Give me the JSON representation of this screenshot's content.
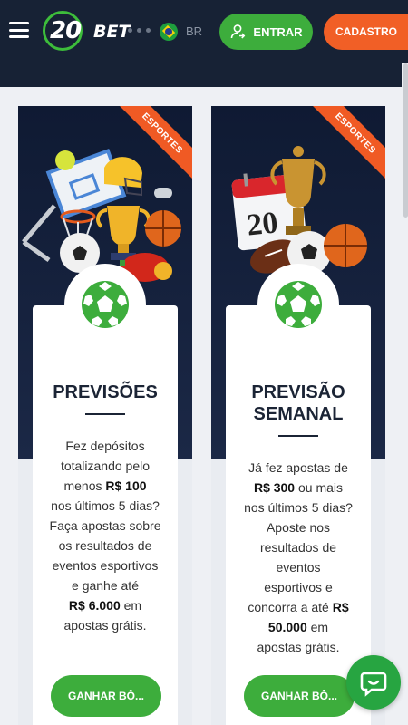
{
  "header": {
    "logo_number": "20",
    "logo_word": "BET",
    "language": "BR",
    "login_label": "ENTRAR",
    "register_label": "CADASTRO"
  },
  "cards": [
    {
      "ribbon": "ESPORTES",
      "title_lines": [
        "PREVISÕES"
      ],
      "desc": [
        "Fez depósitos",
        "totalizando pelo",
        "menos ",
        "R$ 100",
        "nos últimos 5 dias?",
        "Faça apostas sobre",
        "os resultados de",
        "eventos esportivos",
        "e ganhe até",
        "R$ 6.000",
        " em",
        "apostas grátis."
      ],
      "button": "GANHAR BÔ..."
    },
    {
      "ribbon": "ESPORTES",
      "title_lines": [
        "PREVISÃO",
        "SEMANAL"
      ],
      "calendar_number": "20",
      "desc": [
        "Já fez apostas de",
        "R$ 300",
        " ou mais",
        "nos últimos 5 dias?",
        "Aposte nos",
        "resultados de",
        "eventos",
        "esportivos e",
        "concorra a até ",
        "R$",
        "50.000",
        " em",
        "apostas grátis."
      ],
      "button": "GANHAR BÔ..."
    }
  ],
  "colors": {
    "header_bg": "#172235",
    "green": "#3dad3c",
    "orange": "#f15f26"
  },
  "icons": [
    "menu-icon",
    "user-login-icon",
    "brazil-flag-icon",
    "soccer-ball-icon",
    "chat-icon"
  ]
}
